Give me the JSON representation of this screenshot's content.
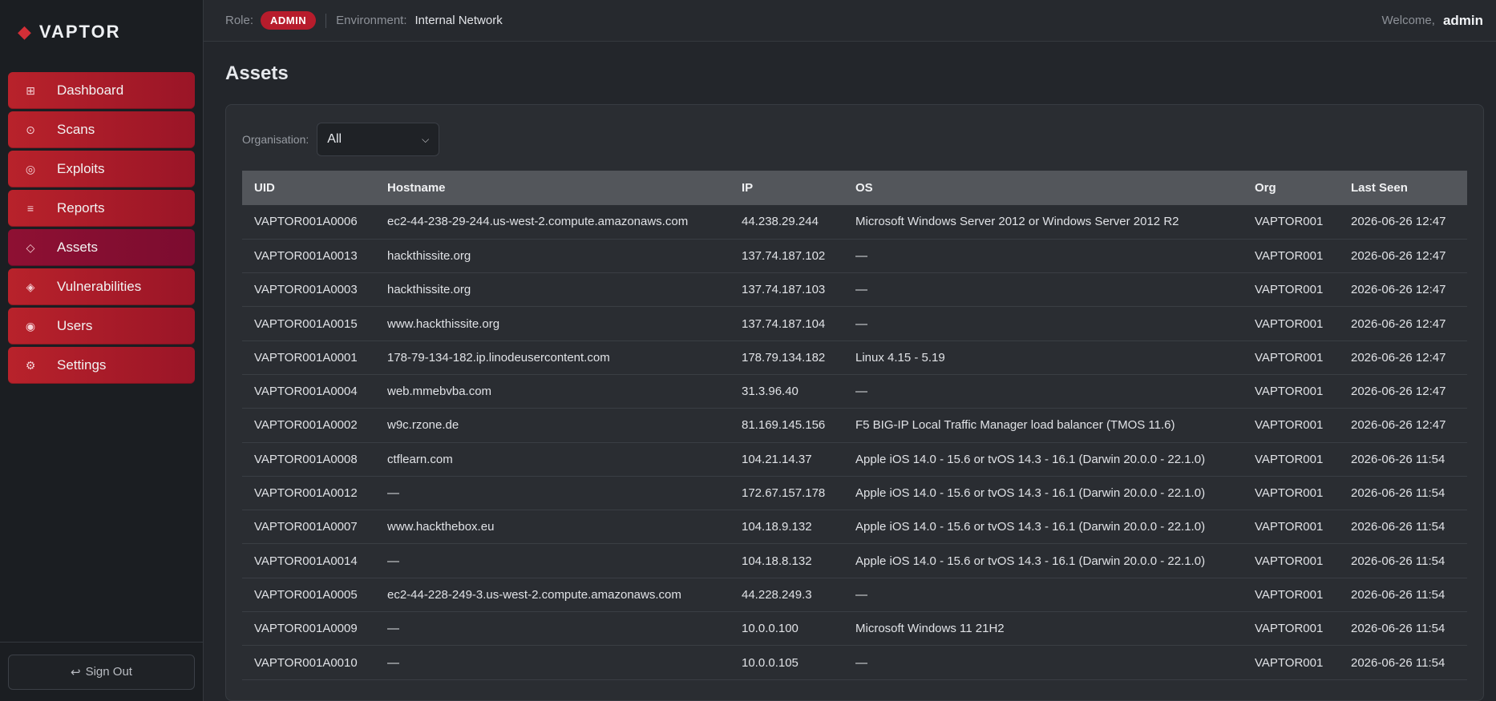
{
  "brand": {
    "name": "VAPTOR",
    "icon": "diamond-icon"
  },
  "sidebar": {
    "items": [
      {
        "label": "Dashboard",
        "icon": "⊞",
        "active": false
      },
      {
        "label": "Scans",
        "icon": "⊙",
        "active": false
      },
      {
        "label": "Exploits",
        "icon": "◎",
        "active": false
      },
      {
        "label": "Reports",
        "icon": "≡",
        "active": false
      },
      {
        "label": "Assets",
        "icon": "◇",
        "active": true
      },
      {
        "label": "Vulnerabilities",
        "icon": "◈",
        "active": false
      },
      {
        "label": "Users",
        "icon": "◉",
        "active": false
      },
      {
        "label": "Settings",
        "icon": "⚙",
        "active": false
      }
    ],
    "signout_label": "Sign Out",
    "signout_icon": "↩"
  },
  "topbar": {
    "role_label": "Role:",
    "role_value": "ADMIN",
    "env_label": "Environment:",
    "env_value": "Internal Network",
    "welcome_label": "Welcome,",
    "user": "admin"
  },
  "page": {
    "title": "Assets",
    "filter_label": "Organisation:",
    "filter_value": "All"
  },
  "table": {
    "columns": [
      "UID",
      "Hostname",
      "IP",
      "OS",
      "Org",
      "Last Seen"
    ],
    "rows": [
      [
        "VAPTOR001A0006",
        "ec2-44-238-29-244.us-west-2.compute.amazonaws.com",
        "44.238.29.244",
        "Microsoft Windows Server 2012 or Windows Server 2012 R2",
        "VAPTOR001",
        "2026-06-26 12:47"
      ],
      [
        "VAPTOR001A0013",
        "hackthissite.org",
        "137.74.187.102",
        "—",
        "VAPTOR001",
        "2026-06-26 12:47"
      ],
      [
        "VAPTOR001A0003",
        "hackthissite.org",
        "137.74.187.103",
        "—",
        "VAPTOR001",
        "2026-06-26 12:47"
      ],
      [
        "VAPTOR001A0015",
        "www.hackthissite.org",
        "137.74.187.104",
        "—",
        "VAPTOR001",
        "2026-06-26 12:47"
      ],
      [
        "VAPTOR001A0001",
        "178-79-134-182.ip.linodeusercontent.com",
        "178.79.134.182",
        "Linux 4.15 - 5.19",
        "VAPTOR001",
        "2026-06-26 12:47"
      ],
      [
        "VAPTOR001A0004",
        "web.mmebvba.com",
        "31.3.96.40",
        "—",
        "VAPTOR001",
        "2026-06-26 12:47"
      ],
      [
        "VAPTOR001A0002",
        "w9c.rzone.de",
        "81.169.145.156",
        "F5 BIG-IP Local Traffic Manager load balancer (TMOS 11.6)",
        "VAPTOR001",
        "2026-06-26 12:47"
      ],
      [
        "VAPTOR001A0008",
        "ctflearn.com",
        "104.21.14.37",
        "Apple iOS 14.0 - 15.6 or tvOS 14.3 - 16.1 (Darwin 20.0.0 - 22.1.0)",
        "VAPTOR001",
        "2026-06-26 11:54"
      ],
      [
        "VAPTOR001A0012",
        "—",
        "172.67.157.178",
        "Apple iOS 14.0 - 15.6 or tvOS 14.3 - 16.1 (Darwin 20.0.0 - 22.1.0)",
        "VAPTOR001",
        "2026-06-26 11:54"
      ],
      [
        "VAPTOR001A0007",
        "www.hackthebox.eu",
        "104.18.9.132",
        "Apple iOS 14.0 - 15.6 or tvOS 14.3 - 16.1 (Darwin 20.0.0 - 22.1.0)",
        "VAPTOR001",
        "2026-06-26 11:54"
      ],
      [
        "VAPTOR001A0014",
        "—",
        "104.18.8.132",
        "Apple iOS 14.0 - 15.6 or tvOS 14.3 - 16.1 (Darwin 20.0.0 - 22.1.0)",
        "VAPTOR001",
        "2026-06-26 11:54"
      ],
      [
        "VAPTOR001A0005",
        "ec2-44-228-249-3.us-west-2.compute.amazonaws.com",
        "44.228.249.3",
        "—",
        "VAPTOR001",
        "2026-06-26 11:54"
      ],
      [
        "VAPTOR001A0009",
        "—",
        "10.0.0.100",
        "Microsoft Windows 11 21H2",
        "VAPTOR001",
        "2026-06-26 11:54"
      ],
      [
        "VAPTOR001A0010",
        "—",
        "10.0.0.105",
        "—",
        "VAPTOR001",
        "2026-06-26 11:54"
      ]
    ]
  }
}
